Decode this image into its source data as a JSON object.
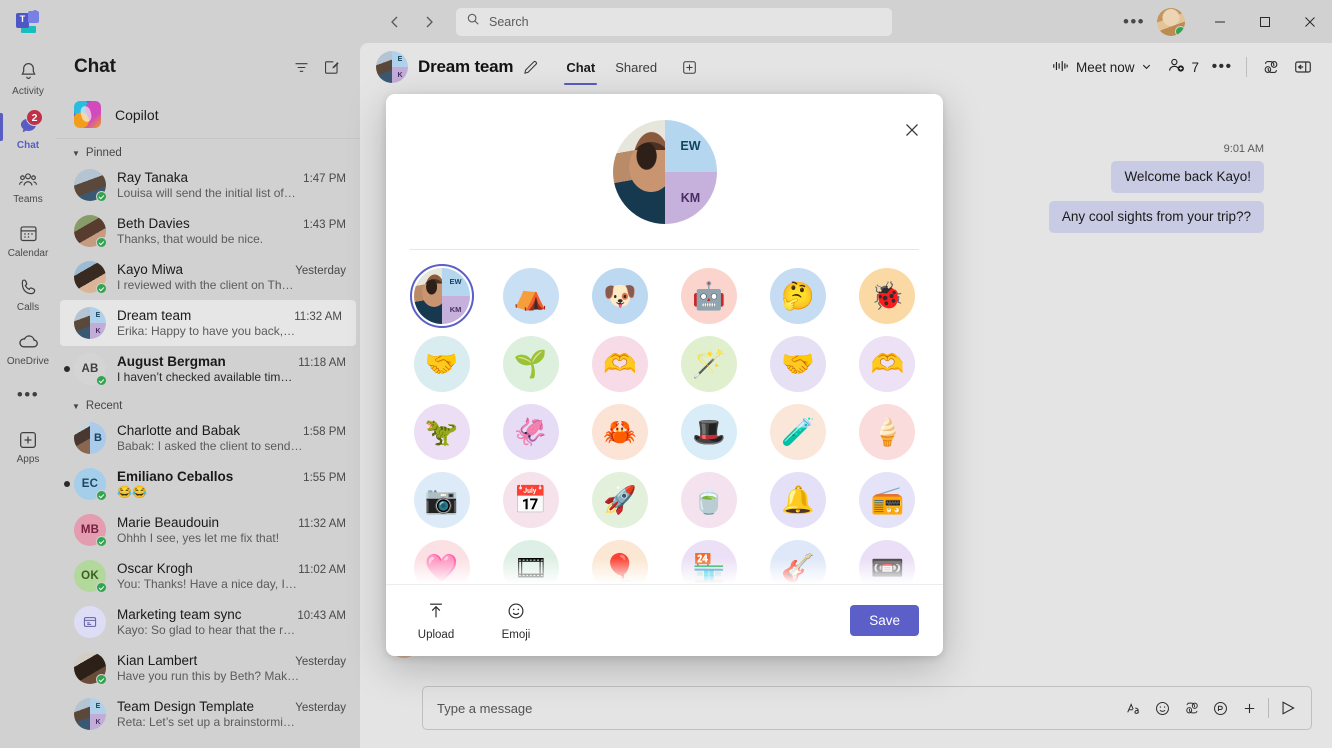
{
  "window": {
    "logo_name": "microsoft-teams-logo",
    "more_label": "•••",
    "minimize_label": "─",
    "maximize_label": "□",
    "close_label": "✕"
  },
  "search": {
    "placeholder": "Search",
    "value": ""
  },
  "rail": {
    "items": [
      {
        "label": "Activity",
        "icon": "bell-icon",
        "active": false,
        "badge": ""
      },
      {
        "label": "Chat",
        "icon": "chat-icon",
        "active": true,
        "badge": "2"
      },
      {
        "label": "Teams",
        "icon": "teams-icon",
        "active": false,
        "badge": ""
      },
      {
        "label": "Calendar",
        "icon": "calendar-icon",
        "active": false,
        "badge": ""
      },
      {
        "label": "Calls",
        "icon": "phone-icon",
        "active": false,
        "badge": ""
      },
      {
        "label": "OneDrive",
        "icon": "cloud-icon",
        "active": false,
        "badge": ""
      }
    ],
    "more_label": "•••",
    "apps_label": "Apps"
  },
  "chat_list": {
    "title": "Chat",
    "filter_icon": "filter-icon",
    "compose_icon": "new-chat-icon",
    "copilot_label": "Copilot",
    "sections": [
      {
        "label": "Pinned",
        "items": [
          {
            "name": "Ray Tanaka",
            "time": "1:47 PM",
            "preview": "Louisa will send the initial list of…",
            "unread": false,
            "selected": false,
            "avatar_kind": "photo",
            "avatar_class": "ph1",
            "presence": "available",
            "initials": ""
          },
          {
            "name": "Beth Davies",
            "time": "1:43 PM",
            "preview": "Thanks, that would be nice.",
            "unread": false,
            "selected": false,
            "avatar_kind": "photo",
            "avatar_class": "ph2",
            "presence": "available",
            "initials": ""
          },
          {
            "name": "Kayo Miwa",
            "time": "Yesterday",
            "preview": "I reviewed with the client on Th…",
            "unread": false,
            "selected": false,
            "avatar_kind": "photo",
            "avatar_class": "ph3",
            "presence": "available",
            "initials": ""
          },
          {
            "name": "Dream team",
            "time": "11:32 AM",
            "preview": "Erika: Happy to have you back,…",
            "unread": false,
            "selected": true,
            "avatar_kind": "dual",
            "avatar_class": "ph1",
            "presence": "",
            "initials": "",
            "q1": "E",
            "q2": "K"
          },
          {
            "name": "August Bergman",
            "time": "11:18 AM",
            "preview": "I haven’t checked available tim…",
            "unread": true,
            "selected": false,
            "avatar_kind": "initials",
            "avatar_bg": "#d9d9d9",
            "avatar_fg": "#424242",
            "presence": "available",
            "initials": "AB"
          }
        ]
      },
      {
        "label": "Recent",
        "items": [
          {
            "name": "Charlotte and Babak",
            "time": "1:58 PM",
            "preview": "Babak: I asked the client to send…",
            "unread": false,
            "selected": false,
            "avatar_kind": "dual-initial",
            "avatar_class": "ph4",
            "presence": "",
            "initials": "",
            "q1": "B"
          },
          {
            "name": "Emiliano Ceballos",
            "time": "1:55 PM",
            "preview": "😂😂",
            "unread": true,
            "selected": false,
            "avatar_kind": "initials",
            "avatar_bg": "#a9d3ef",
            "avatar_fg": "#1b4b63",
            "presence": "available",
            "initials": "EC"
          },
          {
            "name": "Marie Beaudouin",
            "time": "11:32 AM",
            "preview": "Ohhh I see, yes let me fix that!",
            "unread": false,
            "selected": false,
            "avatar_kind": "initials",
            "avatar_bg": "#e8a0b4",
            "avatar_fg": "#7a2140",
            "presence": "available",
            "initials": "MB"
          },
          {
            "name": "Oscar Krogh",
            "time": "11:02 AM",
            "preview": "You: Thanks! Have a nice day, I…",
            "unread": false,
            "selected": false,
            "avatar_kind": "initials",
            "avatar_bg": "#b6dda0",
            "avatar_fg": "#3a6322",
            "presence": "available",
            "initials": "OK"
          },
          {
            "name": "Marketing team sync",
            "time": "10:43 AM",
            "preview": "Kayo: So glad to hear that the r…",
            "unread": false,
            "selected": false,
            "avatar_kind": "group",
            "presence": "",
            "initials": ""
          },
          {
            "name": "Kian Lambert",
            "time": "Yesterday",
            "preview": "Have you run this by Beth? Mak…",
            "unread": false,
            "selected": false,
            "avatar_kind": "photo",
            "avatar_class": "ph5",
            "presence": "available",
            "initials": ""
          },
          {
            "name": "Team Design Template",
            "time": "Yesterday",
            "preview": "Reta: Let’s set up a brainstormi…",
            "unread": false,
            "selected": false,
            "avatar_kind": "dual",
            "avatar_class": "ph1",
            "presence": "",
            "initials": "",
            "q1": "E",
            "q2": "K"
          }
        ]
      }
    ]
  },
  "conversation": {
    "title": "Dream team",
    "edit_icon": "pencil-icon",
    "tabs": [
      {
        "label": "Chat",
        "active": true
      },
      {
        "label": "Shared",
        "active": false
      }
    ],
    "add_tab_icon": "add-tab-icon",
    "meet_now_label": "Meet now",
    "meet_now_icon": "meet-now-icon",
    "meet_now_chevron": "chevron-down-icon",
    "people_count": "7",
    "people_icon": "add-people-icon",
    "overflow_label": "•••",
    "copilot_icon": "copilot-icon",
    "panel_icon": "open-side-panel-icon"
  },
  "messages": {
    "timestamp": "9:01 AM",
    "bubbles": [
      {
        "text": "Welcome back Kayo!"
      },
      {
        "text": "Any cool sights from your trip??"
      }
    ]
  },
  "compose": {
    "placeholder": "Type a message",
    "value": "",
    "icons": [
      {
        "name": "format-icon"
      },
      {
        "name": "emoji-icon"
      },
      {
        "name": "copilot-icon"
      },
      {
        "name": "loop-icon"
      },
      {
        "name": "plus-icon"
      }
    ],
    "send_icon": "send-icon"
  },
  "modal": {
    "close_icon": "close-icon",
    "preview_avatar": {
      "q1": "EW",
      "q2": "KM"
    },
    "avatars": [
      {
        "name": "current-group-avatar",
        "selected": true,
        "kind": "composite",
        "q1": "EW",
        "q2": "KM",
        "bg": "#e8eaf6"
      },
      {
        "name": "camping-avatar",
        "selected": false,
        "glyph": "⛺",
        "bg": "#c9e0f4"
      },
      {
        "name": "dog-avatar",
        "selected": false,
        "glyph": "🐶",
        "bg": "#bdd9f2"
      },
      {
        "name": "robot-avatar",
        "selected": false,
        "glyph": "🤖",
        "bg": "#fbd5cd"
      },
      {
        "name": "thinking-face-avatar",
        "selected": false,
        "glyph": "🤔",
        "bg": "#c5dcf3"
      },
      {
        "name": "bug-avatar",
        "selected": false,
        "glyph": "🐞",
        "bg": "#fbd9a5"
      },
      {
        "name": "high-five-avatar",
        "selected": false,
        "glyph": "🤝",
        "bg": "#d9ecef"
      },
      {
        "name": "plant-hand-avatar",
        "selected": false,
        "glyph": "🌱",
        "bg": "#dcf0dd"
      },
      {
        "name": "care-hands-avatar",
        "selected": false,
        "glyph": "🫶",
        "bg": "#f7dce8"
      },
      {
        "name": "magic-wand-avatar",
        "selected": false,
        "glyph": "🪄",
        "bg": "#e0f0cf"
      },
      {
        "name": "handshake-avatar",
        "selected": false,
        "glyph": "🤝",
        "bg": "#e5e0f3"
      },
      {
        "name": "heart-hands-avatar",
        "selected": false,
        "glyph": "🫶",
        "bg": "#ece1f5"
      },
      {
        "name": "dino-avatar",
        "selected": false,
        "glyph": "🦖",
        "bg": "#ecdff5"
      },
      {
        "name": "octopus-avatar",
        "selected": false,
        "glyph": "🦑",
        "bg": "#e7dcf5"
      },
      {
        "name": "crab-avatar",
        "selected": false,
        "glyph": "🦀",
        "bg": "#fbe3d6"
      },
      {
        "name": "rabbit-hat-avatar",
        "selected": false,
        "glyph": "🎩",
        "bg": "#d8edf8"
      },
      {
        "name": "potion-avatar",
        "selected": false,
        "glyph": "🧪",
        "bg": "#fbe7d9"
      },
      {
        "name": "ice-cream-avatar",
        "selected": false,
        "glyph": "🍦",
        "bg": "#fbdcdc"
      },
      {
        "name": "camera-avatar",
        "selected": false,
        "glyph": "📷",
        "bg": "#ddeaf8"
      },
      {
        "name": "calendar-avatar",
        "selected": false,
        "glyph": "📅",
        "bg": "#f6e2ea"
      },
      {
        "name": "rocket-avatar",
        "selected": false,
        "glyph": "🚀",
        "bg": "#e2f0dc"
      },
      {
        "name": "teacup-avatar",
        "selected": false,
        "glyph": "🍵",
        "bg": "#f4e2ef"
      },
      {
        "name": "bell-avatar",
        "selected": false,
        "glyph": "🔔",
        "bg": "#e3e0f7"
      },
      {
        "name": "boombox-avatar",
        "selected": false,
        "glyph": "📻",
        "bg": "#e5e3f7"
      },
      {
        "name": "heart-avatar",
        "selected": false,
        "glyph": "🩷",
        "bg": "#fbe0e4"
      },
      {
        "name": "film-reel-avatar",
        "selected": false,
        "glyph": "🎞",
        "bg": "#def0e6"
      },
      {
        "name": "hot-air-balloon-avatar",
        "selected": false,
        "glyph": "🎈",
        "bg": "#fbe7d3"
      },
      {
        "name": "storefront-avatar",
        "selected": false,
        "glyph": "🏪",
        "bg": "#ece0f6"
      },
      {
        "name": "guitar-avatar",
        "selected": false,
        "glyph": "🎸",
        "bg": "#dfe8f8"
      },
      {
        "name": "video-folder-avatar",
        "selected": false,
        "glyph": "📼",
        "bg": "#eadff6"
      }
    ],
    "upload_label": "Upload",
    "upload_icon": "upload-icon",
    "emoji_label": "Emoji",
    "emoji_icon": "emoji-icon",
    "save_label": "Save"
  },
  "colors": {
    "accent": "#5b5fc7",
    "badge": "#c4314b",
    "presence_available": "#32a852",
    "bubble": "#cdd0e8",
    "app_bg": "#d6d6d6",
    "main_bg": "#e9e9e9"
  }
}
